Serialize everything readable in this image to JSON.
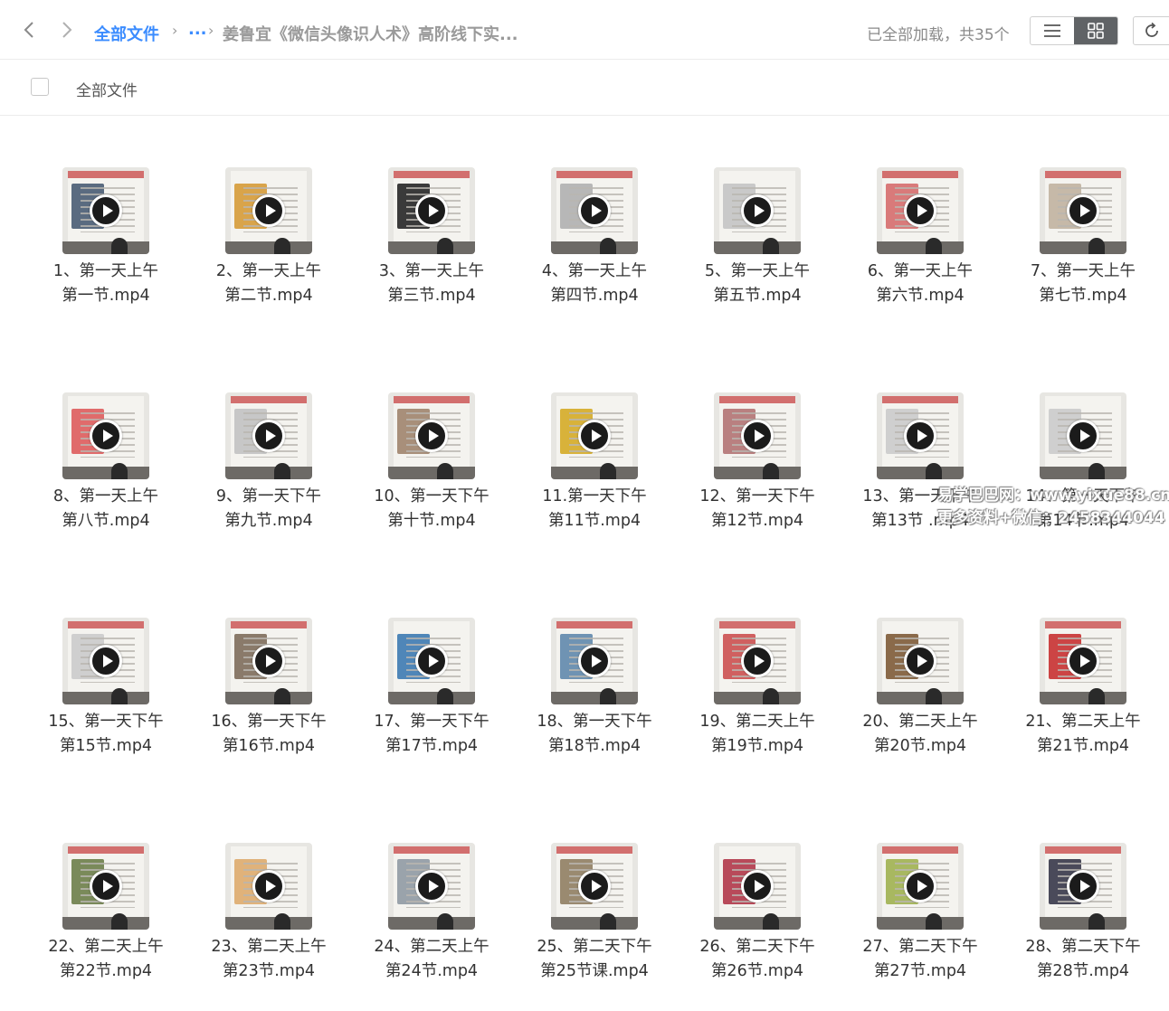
{
  "header": {
    "back_icon": "chevron-left-icon",
    "forward_icon": "chevron-right-icon",
    "breadcrumb_root": "全部文件",
    "breadcrumb_sep": "›",
    "breadcrumb_ellipsis": "...",
    "breadcrumb_current": "姜鲁宜《微信头像识人术》高阶线下实...",
    "loaded_status": "已全部加载，共35个",
    "view_list_icon": "list-view-icon",
    "view_grid_icon": "grid-view-icon",
    "refresh_icon": "refresh-icon",
    "accent_color": "#3b8cff"
  },
  "subbar": {
    "title": "全部文件"
  },
  "files": [
    {
      "line1": "1、第一天上午",
      "line2": "第一节.mp4",
      "accent": "#5a6b80"
    },
    {
      "line1": "2、第一天上午",
      "line2": "第二节.mp4",
      "accent": "#d9a44a"
    },
    {
      "line1": "3、第一天上午",
      "line2": "第三节.mp4",
      "accent": "#3a3a3a"
    },
    {
      "line1": "4、第一天上午",
      "line2": "第四节.mp4",
      "accent": "#b7b7b7"
    },
    {
      "line1": "5、第一天上午",
      "line2": "第五节.mp4",
      "accent": "#c9c9c9"
    },
    {
      "line1": "6、第一天上午",
      "line2": "第六节.mp4",
      "accent": "#d97a7a"
    },
    {
      "line1": "7、第一天上午",
      "line2": "第七节.mp4",
      "accent": "#c6b9a8"
    },
    {
      "line1": "8、第一天上午",
      "line2": "第八节.mp4",
      "accent": "#e06b6b"
    },
    {
      "line1": "9、第一天下午",
      "line2": "第九节.mp4",
      "accent": "#c7c7c7"
    },
    {
      "line1": "10、第一天下午",
      "line2": "第十节.mp4",
      "accent": "#a88f7a"
    },
    {
      "line1": "11.第一天下午",
      "line2": "第11节.mp4",
      "accent": "#d8b23a"
    },
    {
      "line1": "12、第一天下午",
      "line2": "第12节.mp4",
      "accent": "#b98080"
    },
    {
      "line1": "13、第一天下午",
      "line2": "第13节 .mp4",
      "accent": "#cfcfcf"
    },
    {
      "line1": "14、第一天下午",
      "line2": "第14节.mp4",
      "accent": "#cfcfcf"
    },
    {
      "line1": "15、第一天下午",
      "line2": "第15节.mp4",
      "accent": "#cfcfcf"
    },
    {
      "line1": "16、第一天下午",
      "line2": "第16节.mp4",
      "accent": "#8a7a6a"
    },
    {
      "line1": "17、第一天下午",
      "line2": "第17节.mp4",
      "accent": "#4f86b8"
    },
    {
      "line1": "18、第一天下午",
      "line2": "第18节.mp4",
      "accent": "#6f93b3"
    },
    {
      "line1": "19、第二天上午",
      "line2": "第19节.mp4",
      "accent": "#d06060"
    },
    {
      "line1": "20、第二天上午",
      "line2": "第20节.mp4",
      "accent": "#8a6a4a"
    },
    {
      "line1": "21、第二天上午",
      "line2": "第21节.mp4",
      "accent": "#c44"
    },
    {
      "line1": "22、第二天上午",
      "line2": "第22节.mp4",
      "accent": "#7a8a5a"
    },
    {
      "line1": "23、第二天上午",
      "line2": "第23节.mp4",
      "accent": "#e0b27a"
    },
    {
      "line1": "24、第二天上午",
      "line2": "第24节.mp4",
      "accent": "#9aa3ab"
    },
    {
      "line1": "25、第二天下午",
      "line2": "第25节课.mp4",
      "accent": "#9a8a70"
    },
    {
      "line1": "26、第二天下午",
      "line2": "第26节.mp4",
      "accent": "#b84a5a"
    },
    {
      "line1": "27、第二天下午",
      "line2": "第27节.mp4",
      "accent": "#a8b860"
    },
    {
      "line1": "28、第二天下午",
      "line2": "第28节.mp4",
      "accent": "#4a4a5a"
    }
  ],
  "watermark": {
    "line1": "易学巴巴网：www.yixue88.cn",
    "line2": "更多资料+微信：2458344044"
  }
}
